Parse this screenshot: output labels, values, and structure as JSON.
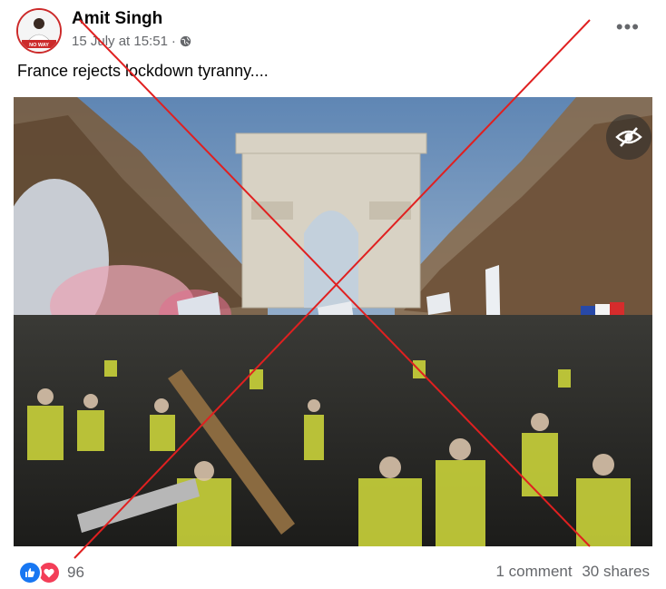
{
  "post": {
    "author": "Amit Singh",
    "timestamp": "15 July at 15:51",
    "privacy_icon": "globe-icon",
    "more_icon": "more-options-icon",
    "text": "France rejects lockdown tyranny...."
  },
  "avatar": {
    "badge_text": "NO WAY",
    "accent": "#cc2a2a"
  },
  "photo": {
    "hide_icon": "eye-slash-icon"
  },
  "reactions": {
    "icons": [
      "like-icon",
      "love-icon"
    ],
    "count": "96",
    "comments": "1 comment",
    "shares": "30 shares"
  },
  "colors": {
    "overlay_x": "#e02020",
    "like_blue": "#1877f2",
    "love_red": "#f33e58",
    "meta_grey": "#65676b"
  }
}
